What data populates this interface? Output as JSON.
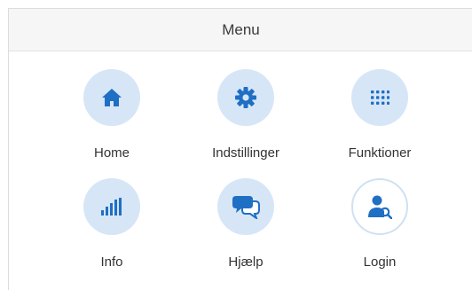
{
  "header": {
    "title": "Menu"
  },
  "items": [
    {
      "label": "Home",
      "icon": "home-icon"
    },
    {
      "label": "Indstillinger",
      "icon": "gear-icon"
    },
    {
      "label": "Funktioner",
      "icon": "grid-icon"
    },
    {
      "label": "Info",
      "icon": "bar-chart-icon"
    },
    {
      "label": "Hjælp",
      "icon": "chat-bubbles-icon"
    },
    {
      "label": "Login",
      "icon": "user-key-icon"
    }
  ],
  "colors": {
    "accent": "#1f6fc4",
    "icon_bg": "#d6e6f7",
    "header_bg": "#f6f6f6"
  }
}
